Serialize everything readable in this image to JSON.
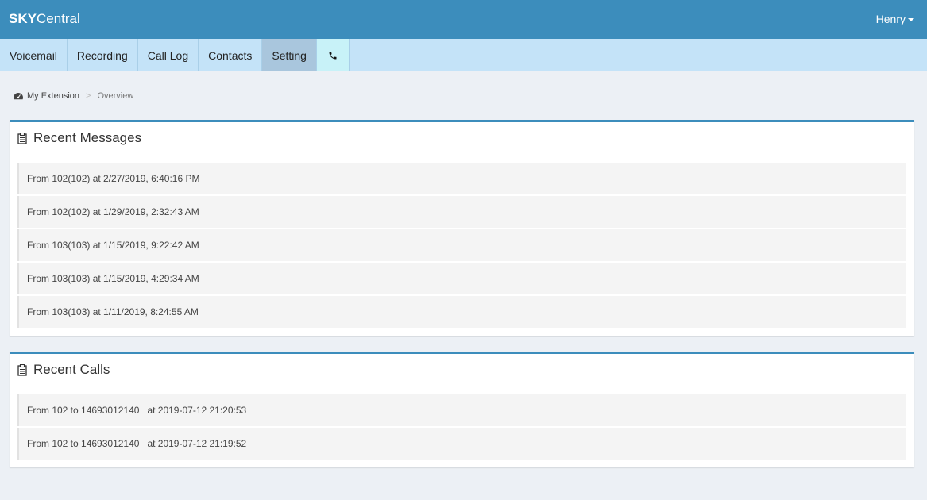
{
  "header": {
    "brand_bold": "SKY",
    "brand_light": "Central",
    "user_name": "Henry"
  },
  "nav": {
    "items": [
      {
        "label": "Voicemail"
      },
      {
        "label": "Recording"
      },
      {
        "label": "Call Log"
      },
      {
        "label": "Contacts"
      },
      {
        "label": "Setting"
      }
    ],
    "active": "Setting",
    "phone_icon": "phone-icon"
  },
  "breadcrumb": {
    "icon": "dashboard-icon",
    "home": "My Extension",
    "separator": ">",
    "current": "Overview"
  },
  "recent_messages": {
    "title": "Recent Messages",
    "icon": "clipboard-icon",
    "items": [
      "From 102(102) at 2/27/2019, 6:40:16 PM",
      "From 102(102) at 1/29/2019, 2:32:43 AM",
      "From 103(103) at 1/15/2019, 9:22:42 AM",
      "From 103(103) at 1/15/2019, 4:29:34 AM",
      "From 103(103) at 1/11/2019, 8:24:55 AM"
    ]
  },
  "recent_calls": {
    "title": "Recent Calls",
    "icon": "clipboard-icon",
    "items": [
      "From 102 to 14693012140   at 2019-07-12 21:20:53",
      "From 102 to 14693012140   at 2019-07-12 21:19:52"
    ]
  },
  "colors": {
    "header_bg": "#3c8dbc",
    "nav_bg": "#c4e3f8",
    "nav_active": "#a9c6dd",
    "nav_phone": "#c8f2f8",
    "page_bg": "#ecf0f5",
    "panel_border": "#3c8dbc"
  }
}
